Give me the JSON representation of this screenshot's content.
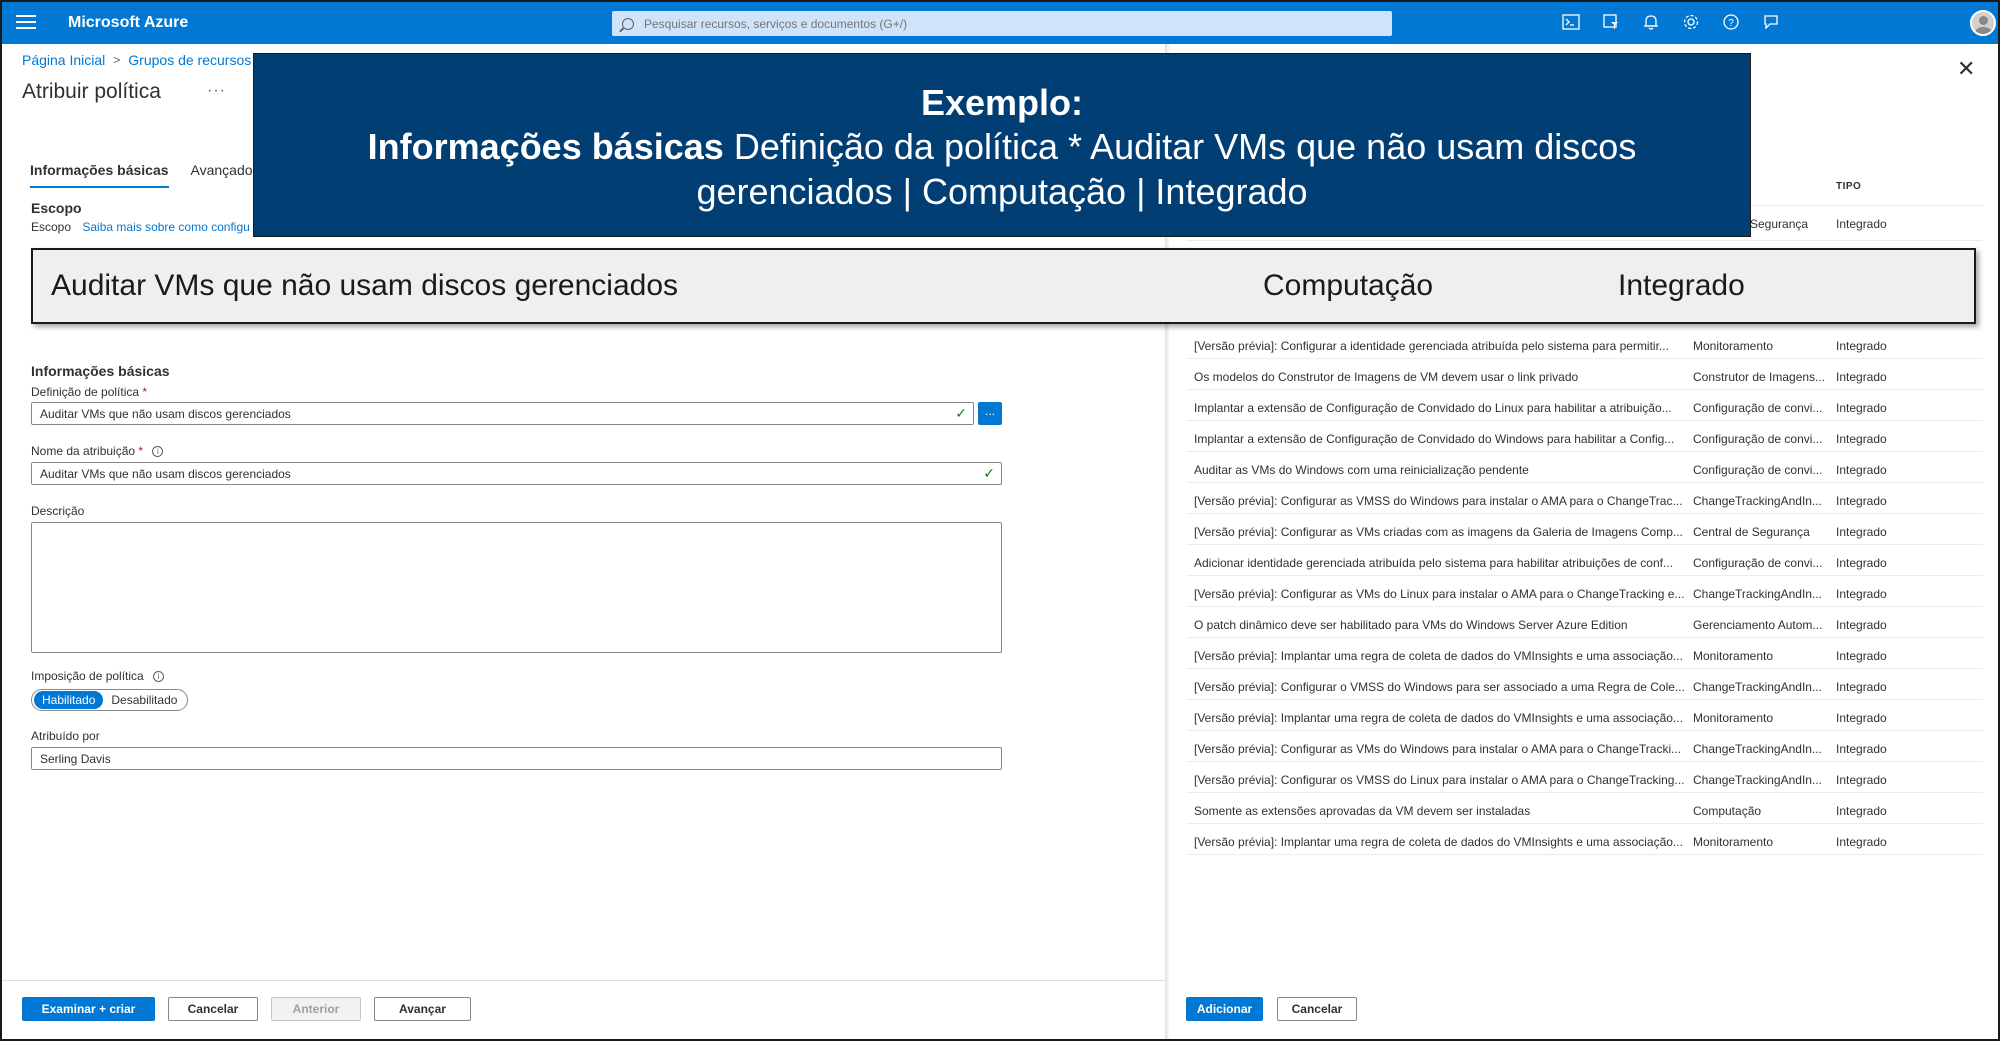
{
  "topbar": {
    "brand": "Microsoft Azure",
    "search_placeholder": "Pesquisar recursos, serviços e documentos (G+/)",
    "icons": [
      "cloud-shell-icon",
      "directory-filter-icon",
      "bell-icon",
      "gear-icon",
      "help-icon",
      "feedback-icon"
    ]
  },
  "breadcrumb": [
    "Página Inicial",
    "Grupos de recursos"
  ],
  "page": {
    "title": "Atribuir política",
    "more": "···"
  },
  "tabs": [
    "Informações básicas",
    "Avançado"
  ],
  "scope": {
    "heading": "Escopo",
    "label": "Escopo",
    "link": "Saiba mais sobre como configu"
  },
  "basics": {
    "heading": "Informações básicas",
    "policy_definition_label": "Definição de política",
    "policy_definition_value": "Auditar VMs que não usam discos gerenciados",
    "ellipsis": "...",
    "assignment_name_label": "Nome da atribuição",
    "assignment_name_value": "Auditar VMs que não usam discos gerenciados",
    "description_label": "Descrição",
    "enforcement_label": "Imposição de política",
    "enforcement_options": [
      "Habilitado",
      "Desabilitado"
    ],
    "assigned_by_label": "Atribuído por",
    "assigned_by_value": "Serling Davis",
    "required_mark": "*"
  },
  "footer_left": {
    "review_create": "Examinar + criar",
    "cancel": "Cancelar",
    "previous": "Anterior",
    "next": "Avançar"
  },
  "right_pane": {
    "column_type": "TIPO",
    "partial_first_row": {
      "category": "Segurança",
      "type": "Integrado"
    },
    "rows": [
      {
        "name": "[Versão prévia]: Configurar a identidade gerenciada atribuída pelo sistema para permitir...",
        "category": "Monitoramento",
        "type": "Integrado"
      },
      {
        "name": "Os modelos do Construtor de Imagens de VM devem usar o link privado",
        "category": "Construtor de Imagens...",
        "type": "Integrado"
      },
      {
        "name": "Implantar a extensão de Configuração de Convidado do Linux para habilitar a atribuição...",
        "category": "Configuração de convi...",
        "type": "Integrado"
      },
      {
        "name": "Implantar a extensão de Configuração de Convidado do Windows para habilitar a Config...",
        "category": "Configuração de convi...",
        "type": "Integrado"
      },
      {
        "name": "Auditar as VMs do Windows com uma reinicialização pendente",
        "category": "Configuração de convi...",
        "type": "Integrado"
      },
      {
        "name": "[Versão prévia]: Configurar as VMSS do Windows para instalar o AMA para o ChangeTrac...",
        "category": "ChangeTrackingAndIn...",
        "type": "Integrado"
      },
      {
        "name": "[Versão prévia]: Configurar as VMs criadas com as imagens da Galeria de Imagens Comp...",
        "category": "Central de Segurança",
        "type": "Integrado"
      },
      {
        "name": "Adicionar identidade gerenciada atribuída pelo sistema para habilitar atribuições de conf...",
        "category": "Configuração de convi...",
        "type": "Integrado"
      },
      {
        "name": "[Versão prévia]: Configurar as VMs do Linux para instalar o AMA para o ChangeTracking e...",
        "category": "ChangeTrackingAndIn...",
        "type": "Integrado"
      },
      {
        "name": "O patch dinâmico deve ser habilitado para VMs do Windows Server Azure Edition",
        "category": "Gerenciamento Autom...",
        "type": "Integrado"
      },
      {
        "name": "[Versão prévia]: Implantar uma regra de coleta de dados do VMInsights e uma associação...",
        "category": "Monitoramento",
        "type": "Integrado"
      },
      {
        "name": "[Versão prévia]: Configurar o VMSS do Windows para ser associado a uma Regra de Cole...",
        "category": "ChangeTrackingAndIn...",
        "type": "Integrado"
      },
      {
        "name": "[Versão prévia]: Implantar uma regra de coleta de dados do VMInsights e uma associação...",
        "category": "Monitoramento",
        "type": "Integrado"
      },
      {
        "name": "[Versão prévia]: Configurar as VMs do Windows para instalar o AMA para o ChangeTracki...",
        "category": "ChangeTrackingAndIn...",
        "type": "Integrado"
      },
      {
        "name": "[Versão prévia]: Configurar os VMSS do Linux para instalar o AMA para o ChangeTracking...",
        "category": "ChangeTrackingAndIn...",
        "type": "Integrado"
      },
      {
        "name": "Somente as extensões aprovadas da VM devem ser instaladas",
        "category": "Computação",
        "type": "Integrado"
      },
      {
        "name": "[Versão prévia]: Implantar uma regra de coleta de dados do VMInsights e uma associação...",
        "category": "Monitoramento",
        "type": "Integrado"
      }
    ],
    "add": "Adicionar",
    "cancel": "Cancelar"
  },
  "callout": {
    "heading": "Exemplo:",
    "bold": "Informações básicas",
    "text": " Definição da política * Auditar VMs que não usam discos gerenciados | Computação | Integrado"
  },
  "highlight": {
    "name": "Auditar VMs que não usam discos gerenciados",
    "category": "Computação",
    "type": "Integrado"
  }
}
